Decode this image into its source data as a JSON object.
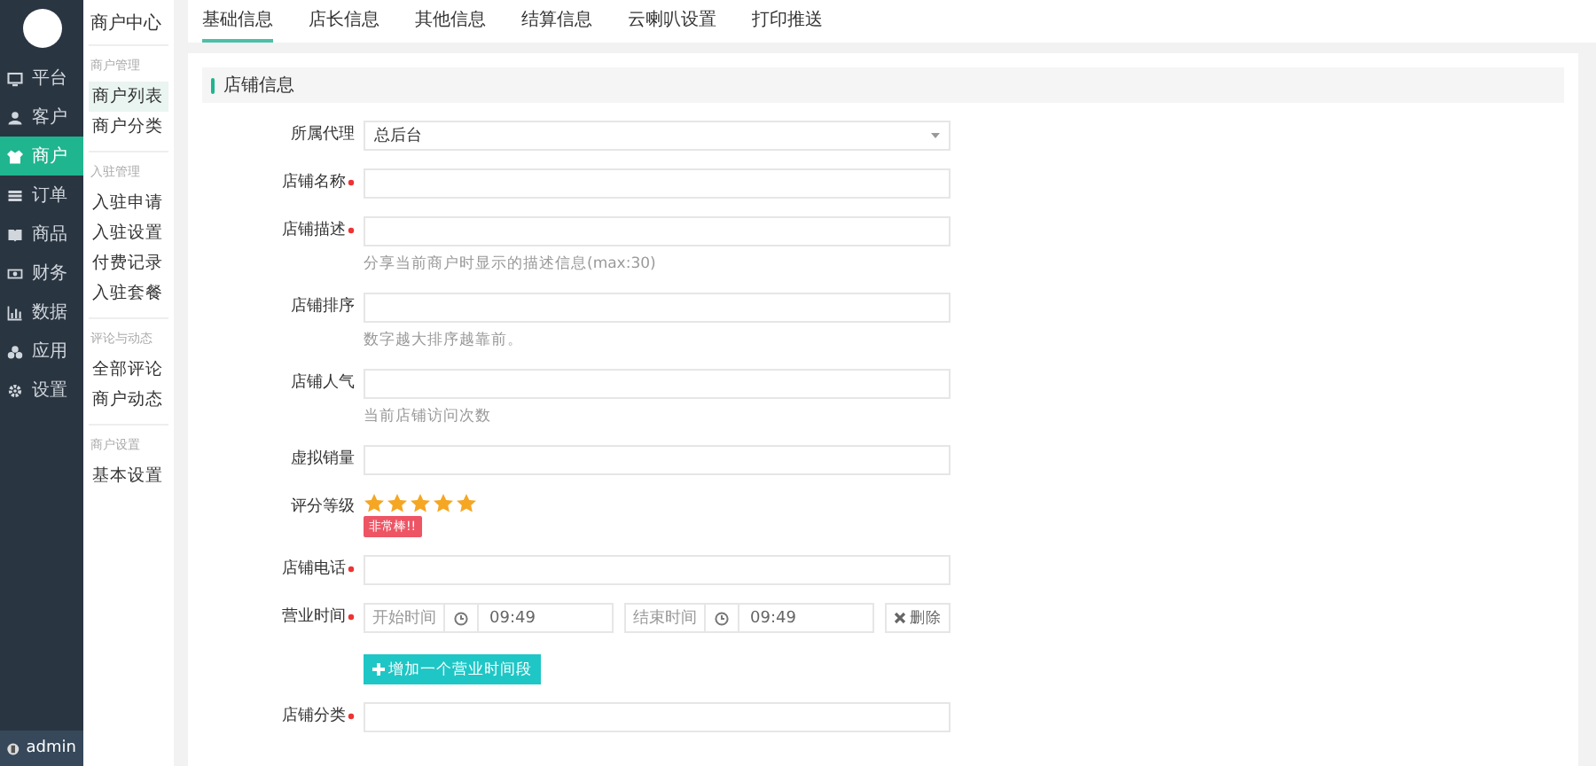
{
  "nav": [
    {
      "label": "平台",
      "selected": false
    },
    {
      "label": "客户",
      "selected": false
    },
    {
      "label": "商户",
      "selected": true
    },
    {
      "label": "订单",
      "selected": false
    },
    {
      "label": "商品",
      "selected": false
    },
    {
      "label": "财务",
      "selected": false
    },
    {
      "label": "数据",
      "selected": false
    },
    {
      "label": "应用",
      "selected": false
    },
    {
      "label": "设置",
      "selected": false
    }
  ],
  "user": "admin",
  "subnav": {
    "title": "商户中心",
    "groups": [
      {
        "heading": "商户管理",
        "items": [
          {
            "label": "商户列表",
            "selected": true
          },
          {
            "label": "商户分类",
            "selected": false
          }
        ]
      },
      {
        "heading": "入驻管理",
        "items": [
          {
            "label": "入驻申请",
            "selected": false
          },
          {
            "label": "入驻设置",
            "selected": false
          },
          {
            "label": "付费记录",
            "selected": false
          },
          {
            "label": "入驻套餐",
            "selected": false
          }
        ]
      },
      {
        "heading": "评论与动态",
        "items": [
          {
            "label": "全部评论",
            "selected": false
          },
          {
            "label": "商户动态",
            "selected": false
          }
        ]
      },
      {
        "heading": "商户设置",
        "items": [
          {
            "label": "基本设置",
            "selected": false
          }
        ]
      }
    ]
  },
  "tabs": [
    {
      "label": "基础信息",
      "selected": true
    },
    {
      "label": "店长信息",
      "selected": false
    },
    {
      "label": "其他信息",
      "selected": false
    },
    {
      "label": "结算信息",
      "selected": false
    },
    {
      "label": "云喇叭设置",
      "selected": false
    },
    {
      "label": "打印推送",
      "selected": false
    }
  ],
  "section_title": "店铺信息",
  "form": [
    {
      "kind": "select",
      "label": "所属代理",
      "required": false,
      "value": "总后台"
    },
    {
      "kind": "input",
      "label": "店铺名称",
      "required": true
    },
    {
      "kind": "input",
      "label": "店铺描述",
      "required": true,
      "hint": "分享当前商户时显示的描述信息(max:30)"
    },
    {
      "kind": "input",
      "label": "店铺排序",
      "required": false,
      "hint": "数字越大排序越靠前。"
    },
    {
      "kind": "input",
      "label": "店铺人气",
      "required": false,
      "hint": "当前店铺访问次数"
    },
    {
      "kind": "input",
      "label": "虚拟销量",
      "required": false
    },
    {
      "kind": "stars",
      "label": "评分等级",
      "required": false,
      "stars": 5,
      "badge": "非常棒!!"
    },
    {
      "kind": "input",
      "label": "店铺电话",
      "required": true
    },
    {
      "kind": "hours",
      "label": "营业时间",
      "required": true,
      "start_label": "开始时间",
      "start": "09:49",
      "end_label": "结束时间",
      "end": "09:49",
      "delete": "删除",
      "add": "增加一个营业时间段"
    },
    {
      "kind": "input",
      "label": "店铺分类",
      "required": true
    }
  ]
}
